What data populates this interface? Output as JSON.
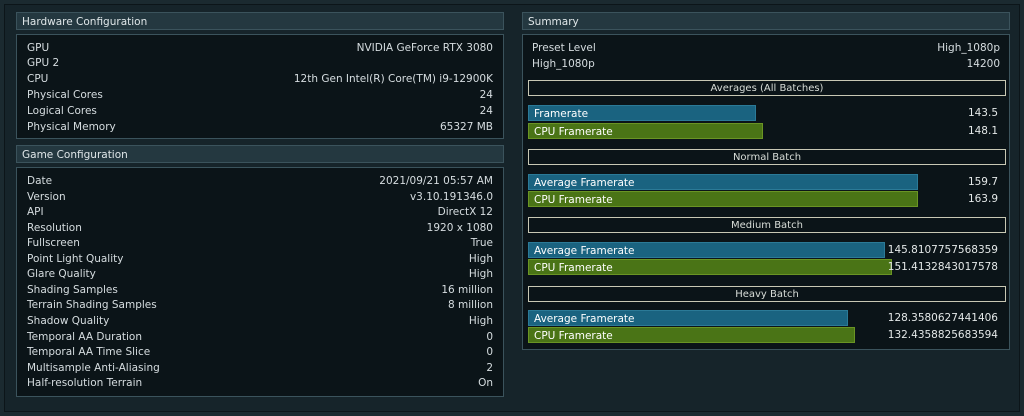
{
  "hardware": {
    "title": "Hardware Configuration",
    "rows": [
      {
        "label": "GPU",
        "value": "NVIDIA GeForce RTX 3080"
      },
      {
        "label": "GPU 2",
        "value": ""
      },
      {
        "label": "CPU",
        "value": "12th Gen Intel(R) Core(TM) i9-12900K"
      },
      {
        "label": "Physical Cores",
        "value": "24"
      },
      {
        "label": "Logical Cores",
        "value": "24"
      },
      {
        "label": "Physical Memory",
        "value": "65327 MB"
      }
    ]
  },
  "game": {
    "title": "Game Configuration",
    "rows": [
      {
        "label": "Date",
        "value": "2021/09/21 05:57 AM"
      },
      {
        "label": "Version",
        "value": "v3.10.191346.0"
      },
      {
        "label": "API",
        "value": "DirectX 12"
      },
      {
        "label": "Resolution",
        "value": "1920 x 1080"
      },
      {
        "label": "Fullscreen",
        "value": "True"
      },
      {
        "label": "Point Light Quality",
        "value": "High"
      },
      {
        "label": "Glare Quality",
        "value": "High"
      },
      {
        "label": "Shading Samples",
        "value": "16 million"
      },
      {
        "label": "Terrain Shading Samples",
        "value": "8 million"
      },
      {
        "label": "Shadow Quality",
        "value": "High"
      },
      {
        "label": "Temporal AA Duration",
        "value": "0"
      },
      {
        "label": "Temporal AA Time Slice",
        "value": "0"
      },
      {
        "label": "Multisample Anti-Aliasing",
        "value": "2"
      },
      {
        "label": "Half-resolution Terrain",
        "value": "On"
      }
    ]
  },
  "summary": {
    "title": "Summary",
    "preset": [
      {
        "label": "Preset Level",
        "value": "High_1080p"
      },
      {
        "label": "High_1080p",
        "value": "14200"
      }
    ],
    "sections": [
      {
        "title": "Averages (All Batches)",
        "bars": [
          {
            "label": "Framerate",
            "value": "143.5",
            "color": "#1a6380",
            "fraction": 0.485
          },
          {
            "label": "CPU Framerate",
            "value": "148.1",
            "color": "#4a7416",
            "fraction": 0.5
          }
        ]
      },
      {
        "title": "Normal Batch",
        "bars": [
          {
            "label": "Average Framerate",
            "value": "159.7",
            "color": "#1a6380",
            "fraction": 0.83
          },
          {
            "label": "CPU Framerate",
            "value": "163.9",
            "color": "#4a7416",
            "fraction": 0.83
          }
        ]
      },
      {
        "title": "Medium Batch",
        "bars": [
          {
            "label": "Average Framerate",
            "value": "145.8107757568359",
            "color": "#1a6380",
            "fraction": 0.76
          },
          {
            "label": "CPU Framerate",
            "value": "151.4132843017578",
            "color": "#4a7416",
            "fraction": 0.775
          }
        ]
      },
      {
        "title": "Heavy Batch",
        "bars": [
          {
            "label": "Average Framerate",
            "value": "128.3580627441406",
            "color": "#1a6380",
            "fraction": 0.68
          },
          {
            "label": "CPU Framerate",
            "value": "132.4358825683594",
            "color": "#4a7416",
            "fraction": 0.695
          }
        ]
      }
    ]
  }
}
